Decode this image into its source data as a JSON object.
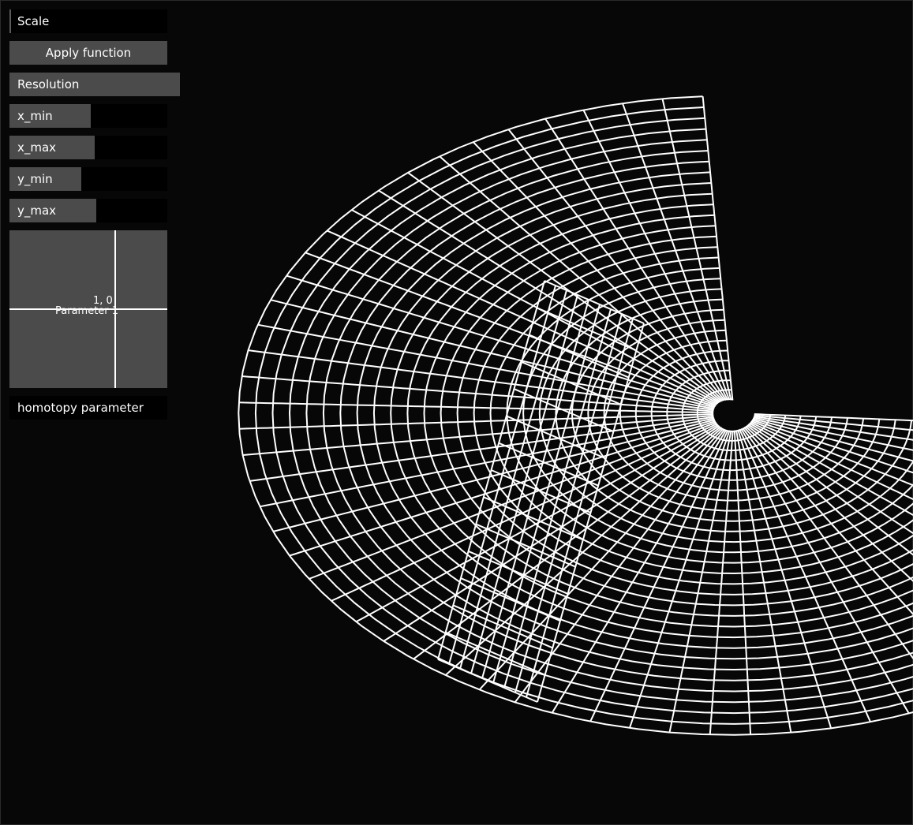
{
  "controls": {
    "scale_label": "Scale",
    "apply_label": "Apply function",
    "resolution_label": "Resolution",
    "x_min_label": "x_min",
    "x_max_label": "x_max",
    "y_min_label": "y_min",
    "y_max_label": "y_max",
    "homotopy_label": "homotopy parameter"
  },
  "parameter_pad": {
    "title": "Parameter 1",
    "value_text": "1, 0"
  },
  "colors": {
    "background": "#070707",
    "panel": "#4b4b4b",
    "grid_line": "#ffffff"
  }
}
